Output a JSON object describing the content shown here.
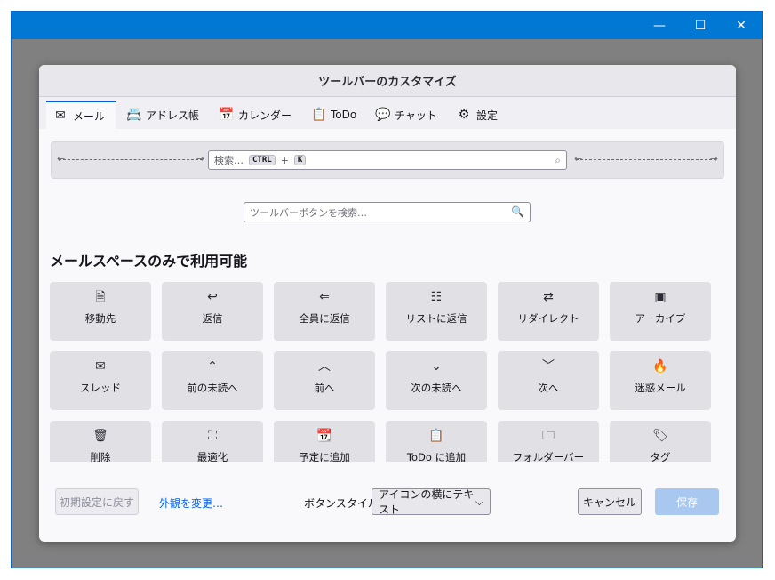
{
  "window": {
    "controls": {
      "minimize": "—",
      "maximize": "☐",
      "close": "✕"
    }
  },
  "dialog": {
    "title": "ツールバーのカスタマイズ",
    "tabs": [
      {
        "label": "メール",
        "icon": "mail-icon",
        "glyph": "✉",
        "active": true
      },
      {
        "label": "アドレス帳",
        "icon": "address-book-icon",
        "glyph": "📇"
      },
      {
        "label": "カレンダー",
        "icon": "calendar-icon",
        "glyph": "📅"
      },
      {
        "label": "ToDo",
        "icon": "todo-clipboard-icon",
        "glyph": "📋"
      },
      {
        "label": "チャット",
        "icon": "chat-icon",
        "glyph": "💬"
      },
      {
        "label": "設定",
        "icon": "gear-icon",
        "glyph": "⚙"
      }
    ],
    "toolbar_search": {
      "placeholder": "検索…",
      "shortcut_key1": "CTRL",
      "shortcut_plus": "+",
      "shortcut_key2": "K",
      "search_glyph": "⌕"
    },
    "spring": {
      "left_arrow": "←",
      "right_arrow": "→"
    },
    "filter": {
      "placeholder": "ツールバーボタンを検索…",
      "search_glyph": "🔍"
    },
    "section_heading": "メールスペースのみで利用可能",
    "buttons": [
      {
        "label": "移動先",
        "icon": "move-to-icon",
        "glyph": "🗎"
      },
      {
        "label": "返信",
        "icon": "reply-icon",
        "glyph": "↩"
      },
      {
        "label": "全員に返信",
        "icon": "reply-all-icon",
        "glyph": "⇐"
      },
      {
        "label": "リストに返信",
        "icon": "reply-list-icon",
        "glyph": "☷"
      },
      {
        "label": "リダイレクト",
        "icon": "redirect-icon",
        "glyph": "⇄"
      },
      {
        "label": "アーカイブ",
        "icon": "archive-icon",
        "glyph": "▣"
      },
      {
        "label": "スレッド",
        "icon": "thread-icon",
        "glyph": "✉"
      },
      {
        "label": "前の未読へ",
        "icon": "previous-unread-icon",
        "glyph": "⌃"
      },
      {
        "label": "前へ",
        "icon": "previous-icon",
        "glyph": "︿"
      },
      {
        "label": "次の未読へ",
        "icon": "next-unread-icon",
        "glyph": "⌄"
      },
      {
        "label": "次へ",
        "icon": "next-icon",
        "glyph": "﹀"
      },
      {
        "label": "迷惑メール",
        "icon": "junk-icon",
        "glyph": "🔥"
      },
      {
        "label": "削除",
        "icon": "trash-icon",
        "glyph": "🗑"
      },
      {
        "label": "最適化",
        "icon": "compact-icon",
        "glyph": "⛶"
      },
      {
        "label": "予定に追加",
        "icon": "add-event-icon",
        "glyph": "📆"
      },
      {
        "label": "ToDo に追加",
        "icon": "add-task-icon",
        "glyph": "📋"
      },
      {
        "label": "フォルダーバー",
        "icon": "folder-icon",
        "glyph": "🗀"
      },
      {
        "label": "タグ",
        "icon": "tag-icon",
        "glyph": "🏷"
      }
    ],
    "footer": {
      "restore_label": "初期設定に戻す",
      "appearance_link": "外観を変更…",
      "button_style_label": "ボタンスタイル:",
      "button_style_value": "アイコンの横にテキスト",
      "select_chevron": "⌵",
      "cancel_label": "キャンセル",
      "save_label": "保存"
    }
  }
}
